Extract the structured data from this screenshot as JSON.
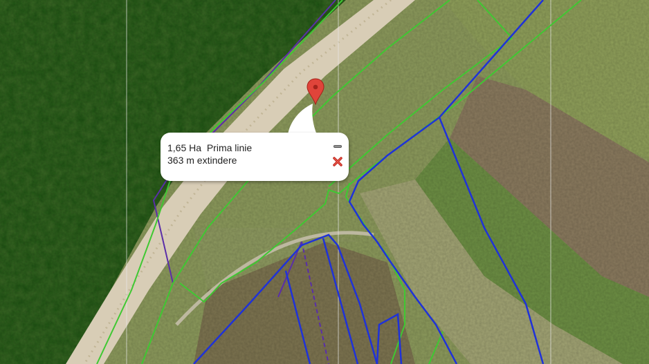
{
  "map": {
    "view": "satellite",
    "marker": {
      "icon": "map-pin-icon",
      "color": "#e0443a"
    },
    "popup": {
      "area": "1,65 Ha",
      "label": "Prima linie",
      "note": "363 m extindere",
      "minimize_icon": "minimize-icon",
      "close_icon": "close-icon"
    },
    "colors": {
      "parcel_outline": "#1f32d8",
      "plot_outline": "#3fc832",
      "boundary_outline": "#5a2ea8"
    }
  }
}
